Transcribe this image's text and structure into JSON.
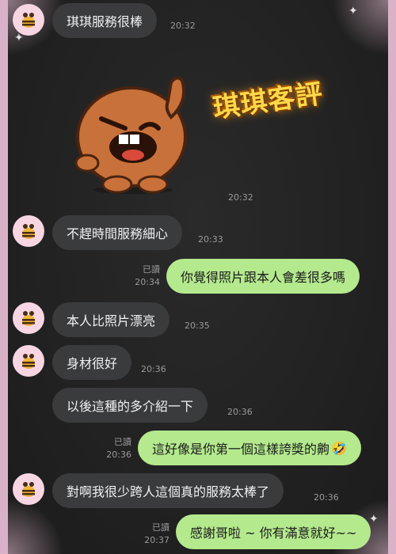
{
  "messages": [
    {
      "text": "琪琪服務很棒",
      "time": "20:32"
    },
    {
      "sticker_text": "琪琪客評",
      "time": "20:32"
    },
    {
      "text": "不趕時間服務細心",
      "time": "20:33"
    },
    {
      "text": "你覺得照片跟本人會差很多嗎",
      "time": "20:34",
      "read": "已讀"
    },
    {
      "text": "本人比照片漂亮",
      "time": "20:35"
    },
    {
      "text": "身材很好",
      "time": "20:36"
    },
    {
      "text": "以後這種的多介紹一下",
      "time": "20:36"
    },
    {
      "text": "這好像是你第一個這樣誇獎的齁",
      "emoji": "🤣",
      "time": "20:36",
      "read": "已讀"
    },
    {
      "text": "對啊我很少跨人這個真的服務太棒了",
      "time": "20:36"
    },
    {
      "text": "感謝哥啦 ~ 你有滿意就好~~",
      "time": "20:37",
      "read": "已讀"
    }
  ],
  "colors": {
    "incoming_bubble": "#3a3b3d",
    "outgoing_bubble": "#b4e98e",
    "frame": "#d9b2c9"
  },
  "icons": {
    "avatar": "bee-avatar-icon",
    "sticker": "cookie-thumbs-up-sticker"
  }
}
